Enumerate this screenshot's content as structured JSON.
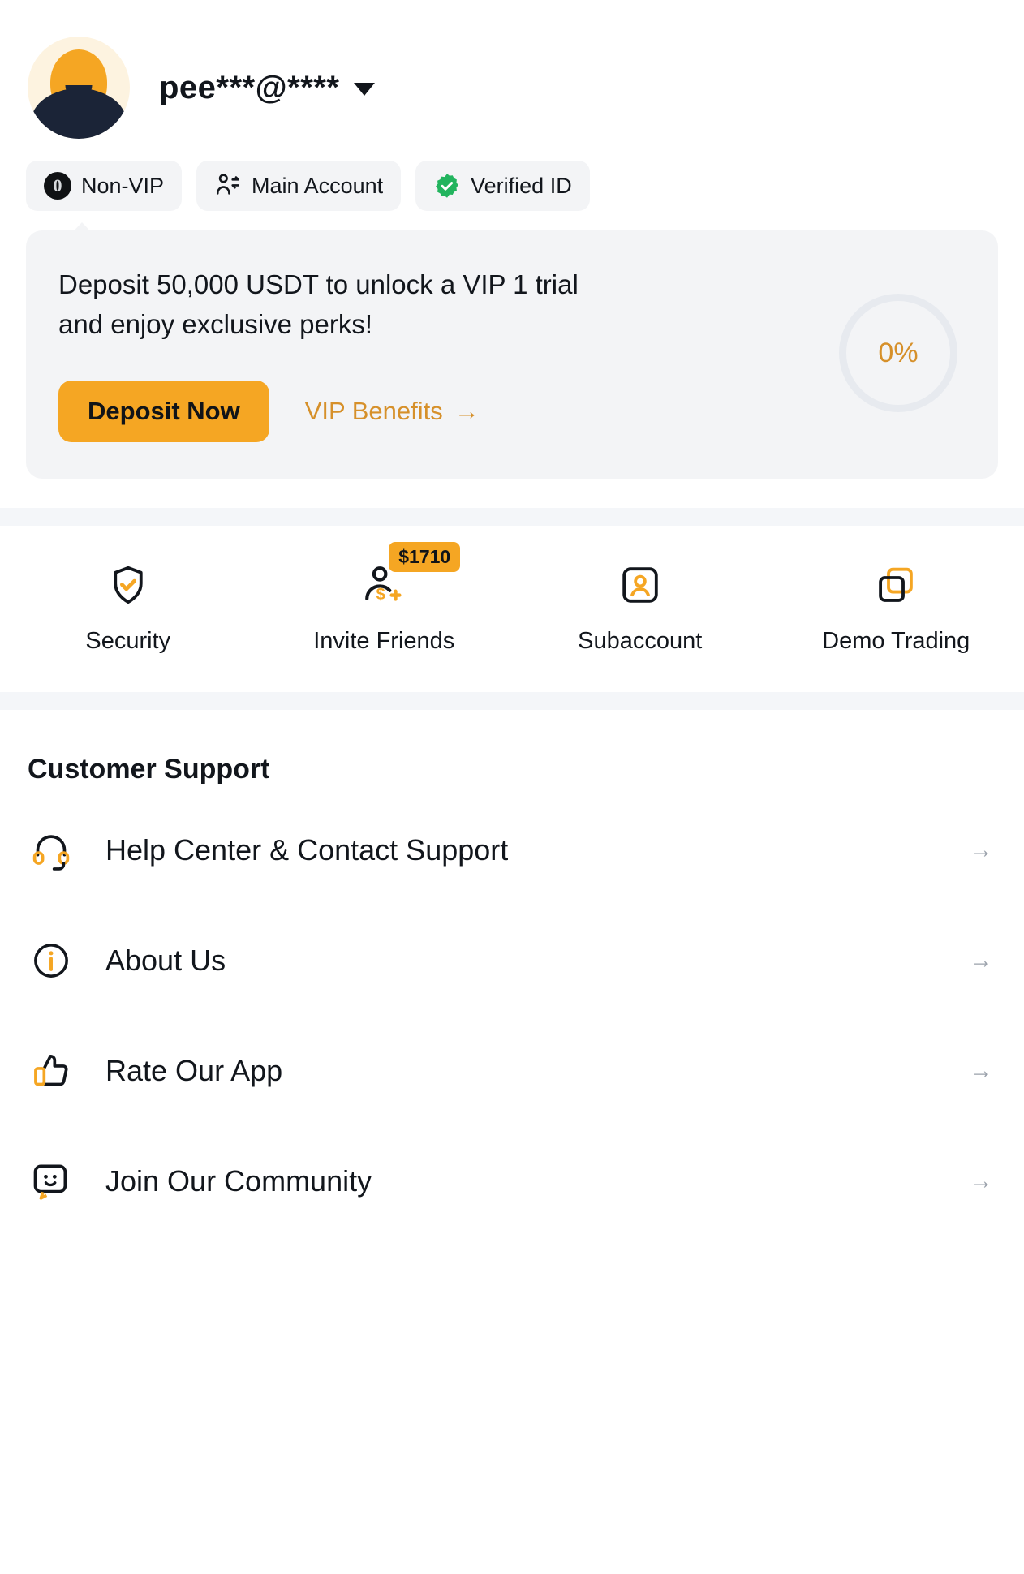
{
  "header": {
    "username": "pee***@****",
    "avatar_icon": "user-avatar",
    "dropdown_icon": "caret-down-icon"
  },
  "badges": [
    {
      "label": "Non-VIP",
      "icon": "vip-level-zero-icon",
      "icon_text": "0"
    },
    {
      "label": "Main Account",
      "icon": "account-switch-icon"
    },
    {
      "label": "Verified ID",
      "icon": "verified-check-icon"
    }
  ],
  "promo": {
    "message": "Deposit 50,000 USDT to unlock a VIP 1 trial and enjoy exclusive perks!",
    "deposit_label": "Deposit Now",
    "benefits_label": "VIP Benefits",
    "benefits_arrow": "→",
    "progress_value": "0%",
    "accent_color": "#f5a623",
    "link_color": "#d6902a"
  },
  "quick_actions": [
    {
      "label": "Security",
      "icon": "shield-check-icon"
    },
    {
      "label": "Invite Friends",
      "icon": "invite-friends-icon",
      "badge": "$1710"
    },
    {
      "label": "Subaccount",
      "icon": "subaccount-icon"
    },
    {
      "label": "Demo Trading",
      "icon": "demo-trading-icon"
    }
  ],
  "support": {
    "title": "Customer Support",
    "items": [
      {
        "label": "Help Center & Contact Support",
        "icon": "headset-icon",
        "chevron": "→"
      },
      {
        "label": "About Us",
        "icon": "info-circle-icon",
        "chevron": "→"
      },
      {
        "label": "Rate Our App",
        "icon": "thumbs-up-icon",
        "chevron": "→"
      },
      {
        "label": "Join Our Community",
        "icon": "chat-smile-icon",
        "chevron": "→"
      }
    ]
  }
}
